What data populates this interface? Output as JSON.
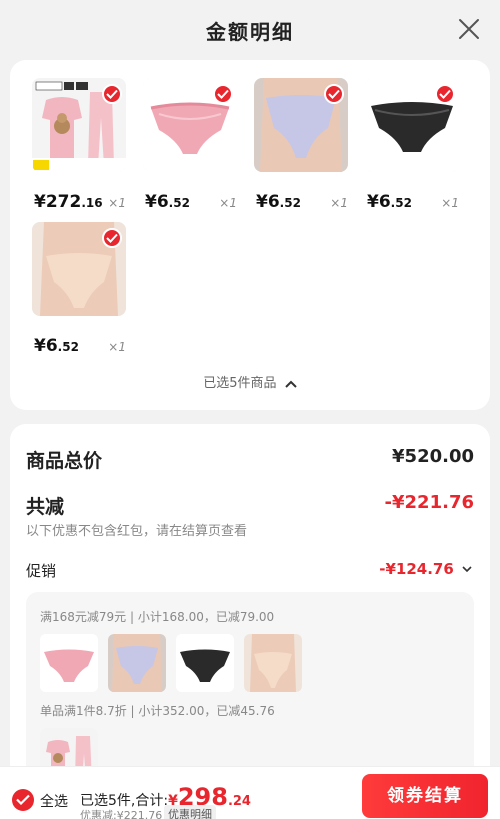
{
  "header": {
    "title": "金额明细"
  },
  "products": [
    {
      "price_int": "¥272",
      "price_dec": ".16",
      "qty": "×1",
      "thumb": "pajama-set"
    },
    {
      "price_int": "¥6",
      "price_dec": ".52",
      "qty": "×1",
      "thumb": "pink-lace-brief"
    },
    {
      "price_int": "¥6",
      "price_dec": ".52",
      "qty": "×1",
      "thumb": "blue-lace-brief-model"
    },
    {
      "price_int": "¥6",
      "price_dec": ".52",
      "qty": "×1",
      "thumb": "black-lace-brief"
    },
    {
      "price_int": "¥6",
      "price_dec": ".52",
      "qty": "×1",
      "thumb": "nude-brief-model"
    }
  ],
  "selected_info": "已选5件商品",
  "summary": {
    "total_label": "商品总价",
    "total_value": "¥520.00",
    "reduce_label": "共减",
    "reduce_value": "-¥221.76",
    "reduce_note": "以下优惠不包含红包，请在结算页查看",
    "promo_label": "促销",
    "promo_value": "-¥124.76",
    "promo_lines": [
      "满168元减79元 | 小计168.00，已减79.00",
      "单品满1件8.7折 | 小计352.00，已减45.76"
    ]
  },
  "bottom": {
    "select_all": "全选",
    "sum_prefix": "已选5件,合计:",
    "sum_currency": "¥",
    "sum_int": "298",
    "sum_dec": ".24",
    "saved": "优惠减:¥221.76",
    "detail_tag": "优惠明细",
    "checkout": "领券结算"
  },
  "colors": {
    "accent": "#e8262e",
    "background": "#f2f2f2"
  }
}
